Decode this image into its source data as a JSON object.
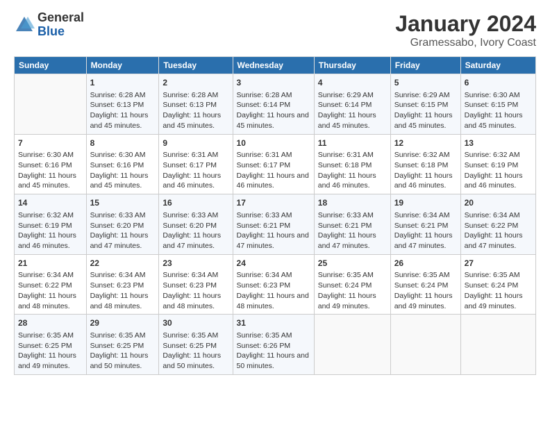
{
  "logo": {
    "general": "General",
    "blue": "Blue"
  },
  "title": "January 2024",
  "location": "Gramessabo, Ivory Coast",
  "days_header": [
    "Sunday",
    "Monday",
    "Tuesday",
    "Wednesday",
    "Thursday",
    "Friday",
    "Saturday"
  ],
  "weeks": [
    [
      {
        "day": "",
        "content": ""
      },
      {
        "day": "1",
        "content": "Sunrise: 6:28 AM\nSunset: 6:13 PM\nDaylight: 11 hours and 45 minutes."
      },
      {
        "day": "2",
        "content": "Sunrise: 6:28 AM\nSunset: 6:13 PM\nDaylight: 11 hours and 45 minutes."
      },
      {
        "day": "3",
        "content": "Sunrise: 6:28 AM\nSunset: 6:14 PM\nDaylight: 11 hours and 45 minutes."
      },
      {
        "day": "4",
        "content": "Sunrise: 6:29 AM\nSunset: 6:14 PM\nDaylight: 11 hours and 45 minutes."
      },
      {
        "day": "5",
        "content": "Sunrise: 6:29 AM\nSunset: 6:15 PM\nDaylight: 11 hours and 45 minutes."
      },
      {
        "day": "6",
        "content": "Sunrise: 6:30 AM\nSunset: 6:15 PM\nDaylight: 11 hours and 45 minutes."
      }
    ],
    [
      {
        "day": "7",
        "content": "Sunrise: 6:30 AM\nSunset: 6:16 PM\nDaylight: 11 hours and 45 minutes."
      },
      {
        "day": "8",
        "content": "Sunrise: 6:30 AM\nSunset: 6:16 PM\nDaylight: 11 hours and 45 minutes."
      },
      {
        "day": "9",
        "content": "Sunrise: 6:31 AM\nSunset: 6:17 PM\nDaylight: 11 hours and 46 minutes."
      },
      {
        "day": "10",
        "content": "Sunrise: 6:31 AM\nSunset: 6:17 PM\nDaylight: 11 hours and 46 minutes."
      },
      {
        "day": "11",
        "content": "Sunrise: 6:31 AM\nSunset: 6:18 PM\nDaylight: 11 hours and 46 minutes."
      },
      {
        "day": "12",
        "content": "Sunrise: 6:32 AM\nSunset: 6:18 PM\nDaylight: 11 hours and 46 minutes."
      },
      {
        "day": "13",
        "content": "Sunrise: 6:32 AM\nSunset: 6:19 PM\nDaylight: 11 hours and 46 minutes."
      }
    ],
    [
      {
        "day": "14",
        "content": "Sunrise: 6:32 AM\nSunset: 6:19 PM\nDaylight: 11 hours and 46 minutes."
      },
      {
        "day": "15",
        "content": "Sunrise: 6:33 AM\nSunset: 6:20 PM\nDaylight: 11 hours and 47 minutes."
      },
      {
        "day": "16",
        "content": "Sunrise: 6:33 AM\nSunset: 6:20 PM\nDaylight: 11 hours and 47 minutes."
      },
      {
        "day": "17",
        "content": "Sunrise: 6:33 AM\nSunset: 6:21 PM\nDaylight: 11 hours and 47 minutes."
      },
      {
        "day": "18",
        "content": "Sunrise: 6:33 AM\nSunset: 6:21 PM\nDaylight: 11 hours and 47 minutes."
      },
      {
        "day": "19",
        "content": "Sunrise: 6:34 AM\nSunset: 6:21 PM\nDaylight: 11 hours and 47 minutes."
      },
      {
        "day": "20",
        "content": "Sunrise: 6:34 AM\nSunset: 6:22 PM\nDaylight: 11 hours and 47 minutes."
      }
    ],
    [
      {
        "day": "21",
        "content": "Sunrise: 6:34 AM\nSunset: 6:22 PM\nDaylight: 11 hours and 48 minutes."
      },
      {
        "day": "22",
        "content": "Sunrise: 6:34 AM\nSunset: 6:23 PM\nDaylight: 11 hours and 48 minutes."
      },
      {
        "day": "23",
        "content": "Sunrise: 6:34 AM\nSunset: 6:23 PM\nDaylight: 11 hours and 48 minutes."
      },
      {
        "day": "24",
        "content": "Sunrise: 6:34 AM\nSunset: 6:23 PM\nDaylight: 11 hours and 48 minutes."
      },
      {
        "day": "25",
        "content": "Sunrise: 6:35 AM\nSunset: 6:24 PM\nDaylight: 11 hours and 49 minutes."
      },
      {
        "day": "26",
        "content": "Sunrise: 6:35 AM\nSunset: 6:24 PM\nDaylight: 11 hours and 49 minutes."
      },
      {
        "day": "27",
        "content": "Sunrise: 6:35 AM\nSunset: 6:24 PM\nDaylight: 11 hours and 49 minutes."
      }
    ],
    [
      {
        "day": "28",
        "content": "Sunrise: 6:35 AM\nSunset: 6:25 PM\nDaylight: 11 hours and 49 minutes."
      },
      {
        "day": "29",
        "content": "Sunrise: 6:35 AM\nSunset: 6:25 PM\nDaylight: 11 hours and 50 minutes."
      },
      {
        "day": "30",
        "content": "Sunrise: 6:35 AM\nSunset: 6:25 PM\nDaylight: 11 hours and 50 minutes."
      },
      {
        "day": "31",
        "content": "Sunrise: 6:35 AM\nSunset: 6:26 PM\nDaylight: 11 hours and 50 minutes."
      },
      {
        "day": "",
        "content": ""
      },
      {
        "day": "",
        "content": ""
      },
      {
        "day": "",
        "content": ""
      }
    ]
  ]
}
